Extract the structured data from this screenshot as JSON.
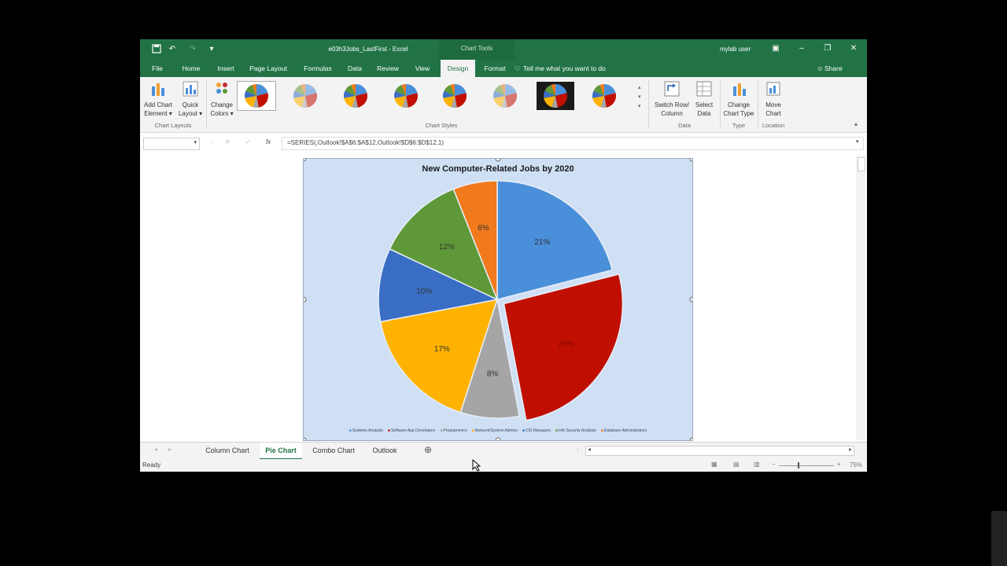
{
  "titlebar": {
    "doc_title": "e03h3Jobs_LastFirst - Excel",
    "context_tools": "Chart Tools",
    "user": "mylab user"
  },
  "tabs": [
    "File",
    "Home",
    "Insert",
    "Page Layout",
    "Formulas",
    "Data",
    "Review",
    "View",
    "Design",
    "Format"
  ],
  "active_tab": "Design",
  "tell_me": "Tell me what you want to do",
  "share": "Share",
  "ribbon": {
    "add_chart_element": [
      "Add Chart",
      "Element"
    ],
    "quick_layout": [
      "Quick",
      "Layout"
    ],
    "change_colors": [
      "Change",
      "Colors"
    ],
    "switch_row_column": [
      "Switch Row/",
      "Column"
    ],
    "select_data": [
      "Select",
      "Data"
    ],
    "change_chart_type": [
      "Change",
      "Chart Type"
    ],
    "move_chart": [
      "Move",
      "Chart"
    ],
    "groups": {
      "chart_layouts": "Chart Layouts",
      "chart_styles": "Chart Styles",
      "data": "Data",
      "type": "Type",
      "location": "Location"
    }
  },
  "formula_bar": {
    "name_box": "",
    "fx": "fx",
    "formula": "=SERIES(,Outlook!$A$6:$A$12,Outlook!$D$6:$D$12,1)"
  },
  "chart_data": {
    "type": "pie",
    "title": "New Computer-Related Jobs by 2020",
    "categories": [
      "Systems Analysts",
      "Software App Developers",
      "Programmers",
      "Network/System Admins",
      "CIS Managers",
      "Info Security Analysts",
      "Database Administrators"
    ],
    "values": [
      21,
      26,
      8,
      17,
      10,
      12,
      6
    ],
    "labels": [
      "21%",
      "26%",
      "8%",
      "17%",
      "10%",
      "12%",
      "6%"
    ],
    "colors": [
      "#4a8fd9",
      "#c00f00",
      "#a5a5a5",
      "#ffb300",
      "#3a6ec4",
      "#5f9839",
      "#f07a1c"
    ],
    "exploded": [
      "Software App Developers"
    ],
    "legend_position": "bottom"
  },
  "sheet_tabs": [
    "Column Chart",
    "Pie Chart",
    "Combo Chart",
    "Outlook"
  ],
  "active_sheet": "Pie Chart",
  "status": {
    "ready": "Ready",
    "zoom": "75%"
  }
}
